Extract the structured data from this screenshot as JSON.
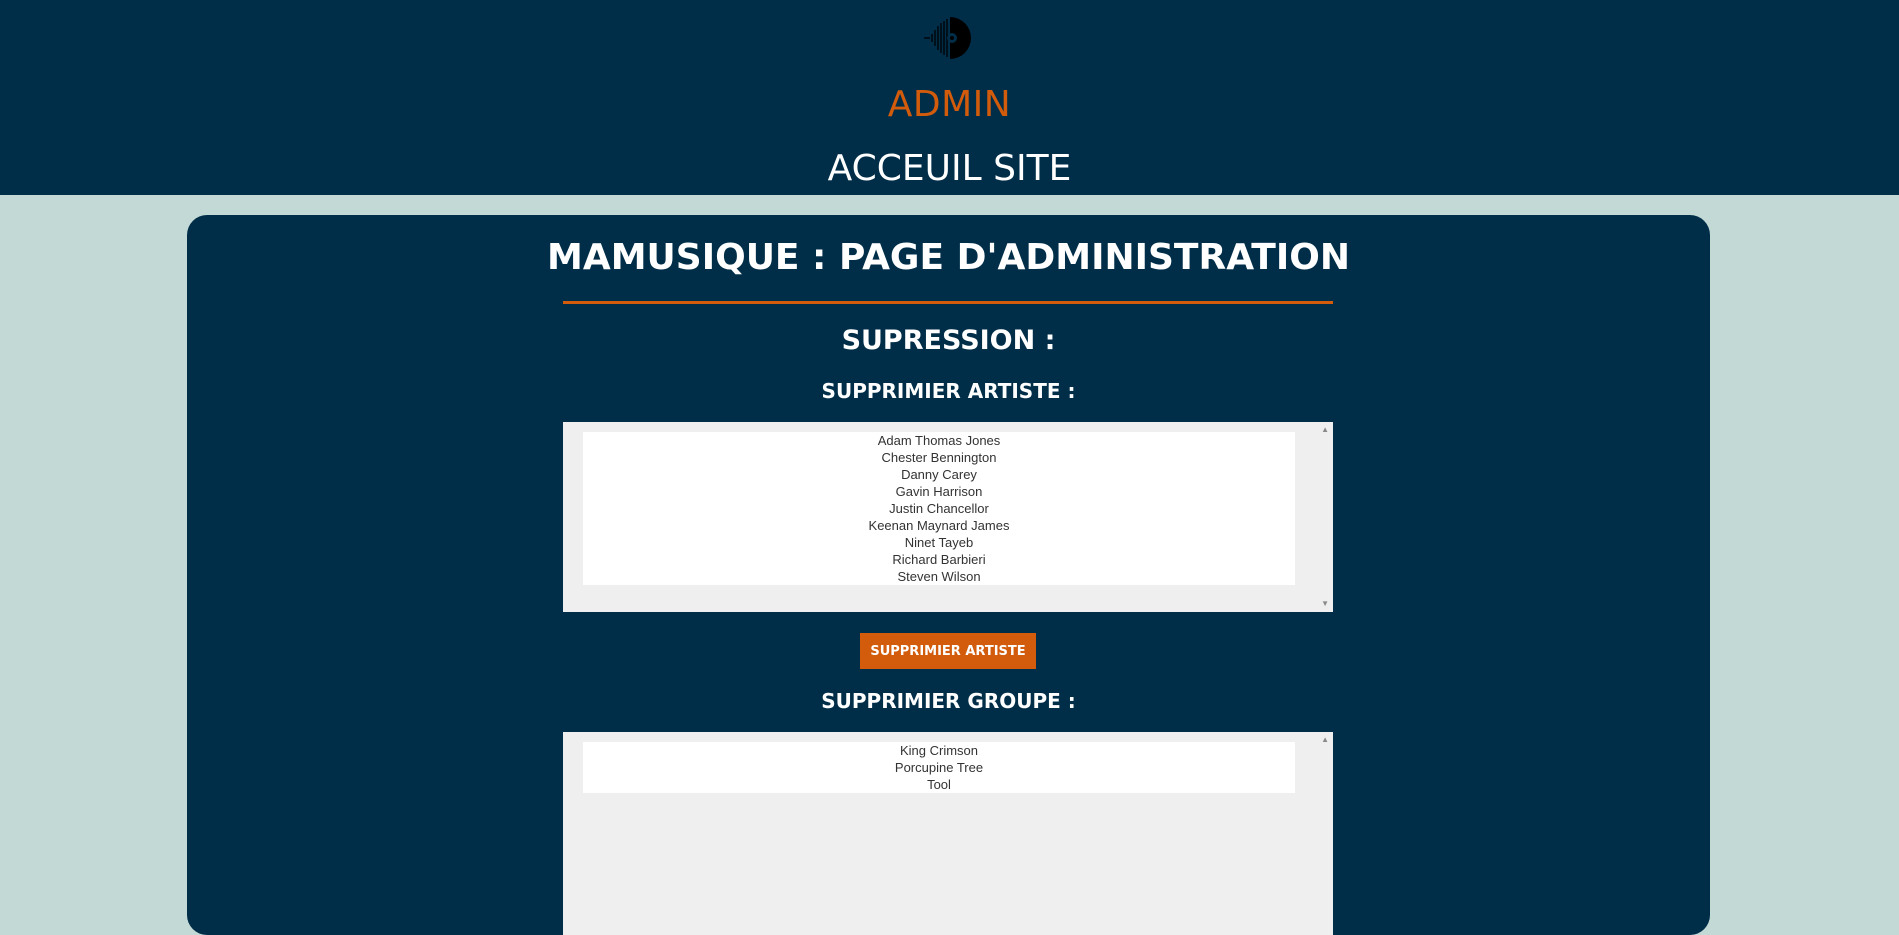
{
  "header": {
    "logo_icon": "vinyl-record-icon",
    "admin_title": "ADMIN",
    "home_link": "ACCEUIL SITE"
  },
  "main": {
    "page_title": "MAMUSIQUE : PAGE D'ADMINISTRATION",
    "section_title": "SUPRESSION :",
    "artists": {
      "title": "SUPPRIMIER ARTISTE :",
      "options": [
        "Adam Thomas Jones",
        "Chester Bennington",
        "Danny Carey",
        "Gavin Harrison",
        "Justin Chancellor",
        "Keenan Maynard James",
        "Ninet Tayeb",
        "Richard Barbieri",
        "Steven Wilson"
      ],
      "button_label": "SUPPRIMIER ARTISTE"
    },
    "groups": {
      "title": "SUPPRIMIER GROUPE :",
      "options": [
        "King Crimson",
        "Porcupine Tree",
        "Tool"
      ]
    }
  },
  "colors": {
    "navy": "#002e49",
    "accent_orange": "#d25b0c",
    "page_background": "#c3d9d5",
    "listbox_background": "#efefef"
  }
}
